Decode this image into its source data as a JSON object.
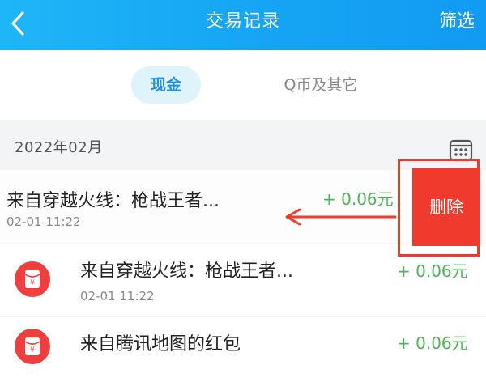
{
  "header": {
    "title": "交易记录",
    "filter_label": "筛选",
    "back_icon": "chevron-left-icon",
    "background_color": "#16a6f4"
  },
  "tabs": [
    {
      "label": "现金",
      "selected": true
    },
    {
      "label": "Q币及其它",
      "selected": false
    }
  ],
  "month": {
    "label": "2022年02月",
    "calendar_icon": "calendar-icon"
  },
  "records": [
    {
      "title": "来自穿越火线：枪战王者...",
      "time": "02-01 11:22",
      "amount": "+ 0.06元",
      "swiped": true
    },
    {
      "title": "来自穿越火线：枪战王者...",
      "time": "02-01 11:22",
      "amount": "+ 0.06元",
      "icon": "red-packet-icon"
    },
    {
      "title": "来自腾讯地图的红包",
      "time": "",
      "amount": "+ 0.06元",
      "icon": "red-packet-icon"
    }
  ],
  "swipe_action": {
    "delete_label": "删除",
    "color": "#f03a2d",
    "annotation": "arrow-left-icon"
  },
  "colors": {
    "amount_green": "#4cb454",
    "tab_selected_bg": "#dff3fb",
    "tab_selected_text": "#2290d9"
  }
}
